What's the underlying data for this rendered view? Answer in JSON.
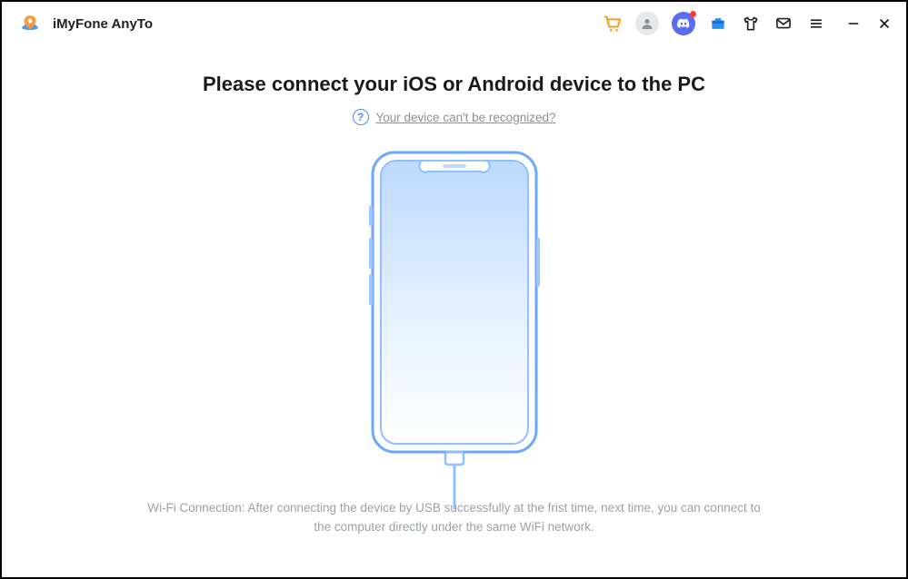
{
  "app": {
    "title": "iMyFone AnyTo"
  },
  "toolbar": {
    "icons": {
      "cart": "cart-icon",
      "user": "user-icon",
      "discord": "discord-icon",
      "toolbox": "toolbox-icon",
      "shirt": "shirt-icon",
      "mail": "mail-icon",
      "menu": "menu-icon"
    }
  },
  "window_controls": {
    "minimize": "minimize",
    "close": "close"
  },
  "main": {
    "headline": "Please connect your iOS or Android device to the PC",
    "help_link": "Your device can't be recognized?",
    "footer_note": "Wi-Fi Connection: After connecting the device by USB successfully at the frist time, next time, you can connect to the computer directly under the same WiFi network."
  },
  "colors": {
    "accent_blue": "#5b6cf0",
    "phone_stroke": "#6aa8ff",
    "help_icon": "#4b8bf4",
    "orange": "#ff9a1a",
    "muted_text": "#9aa0a8"
  }
}
